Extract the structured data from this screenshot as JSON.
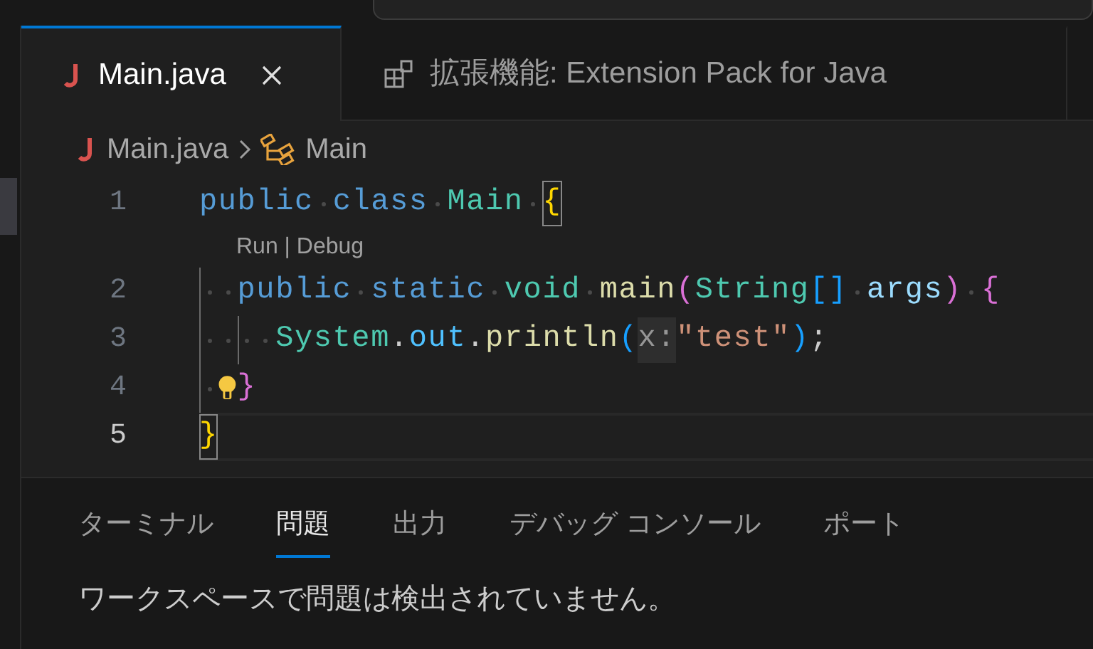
{
  "editor_tabs": [
    {
      "label": "Main.java",
      "kind": "java",
      "selected": true,
      "closable": true
    },
    {
      "label": "拡張機能: Extension Pack for Java",
      "kind": "extensions",
      "selected": false,
      "closable": false
    }
  ],
  "breadcrumb": [
    {
      "label": "Main.java",
      "kind": "java"
    },
    {
      "label": "Main",
      "kind": "class"
    }
  ],
  "code_lines": [
    {
      "number": "1",
      "current": false,
      "tokens": [
        {
          "kind": "keyword",
          "text": "public"
        },
        {
          "kind": "ws"
        },
        {
          "kind": "keyword",
          "text": "class"
        },
        {
          "kind": "ws"
        },
        {
          "kind": "type",
          "text": "Main"
        },
        {
          "kind": "ws"
        },
        {
          "kind": "bracket1_matched",
          "text": "{"
        }
      ],
      "codelens": "Run | Debug"
    },
    {
      "number": "2",
      "current": false,
      "tokens": [
        {
          "kind": "ws_guide"
        },
        {
          "kind": "ws"
        },
        {
          "kind": "keyword",
          "text": "public"
        },
        {
          "kind": "ws"
        },
        {
          "kind": "keyword",
          "text": "static"
        },
        {
          "kind": "ws"
        },
        {
          "kind": "type",
          "text": "void"
        },
        {
          "kind": "ws"
        },
        {
          "kind": "function",
          "text": "main"
        },
        {
          "kind": "bracket2",
          "text": "("
        },
        {
          "kind": "type",
          "text": "String"
        },
        {
          "kind": "bracket3",
          "text": "[]"
        },
        {
          "kind": "ws"
        },
        {
          "kind": "variable",
          "text": "args"
        },
        {
          "kind": "bracket2",
          "text": ")"
        },
        {
          "kind": "ws"
        },
        {
          "kind": "bracket2",
          "text": "{"
        }
      ]
    },
    {
      "number": "3",
      "current": false,
      "tokens": [
        {
          "kind": "ws_guide"
        },
        {
          "kind": "ws"
        },
        {
          "kind": "ws_guide"
        },
        {
          "kind": "ws"
        },
        {
          "kind": "type",
          "text": "System"
        },
        {
          "kind": "punct",
          "text": "."
        },
        {
          "kind": "field",
          "text": "out"
        },
        {
          "kind": "punct",
          "text": "."
        },
        {
          "kind": "function",
          "text": "println"
        },
        {
          "kind": "bracket3",
          "text": "("
        },
        {
          "kind": "hint",
          "text": "x:"
        },
        {
          "kind": "string",
          "text": "\"test\""
        },
        {
          "kind": "bracket3",
          "text": ")"
        },
        {
          "kind": "punct",
          "text": ";"
        }
      ]
    },
    {
      "number": "4",
      "current": false,
      "tokens": [
        {
          "kind": "ws_guide"
        },
        {
          "kind": "bulb"
        },
        {
          "kind": "bracket2",
          "text": "}"
        }
      ]
    },
    {
      "number": "5",
      "current": true,
      "tokens": [
        {
          "kind": "bracket1_matched",
          "text": "}"
        }
      ]
    }
  ],
  "panel": {
    "tabs": [
      {
        "label": "ターミナル",
        "selected": false
      },
      {
        "label": "問題",
        "selected": true
      },
      {
        "label": "出力",
        "selected": false
      },
      {
        "label": "デバッグ コンソール",
        "selected": false
      },
      {
        "label": "ポート",
        "selected": false
      }
    ],
    "message": "ワークスペースで問題は検出されていません。"
  }
}
